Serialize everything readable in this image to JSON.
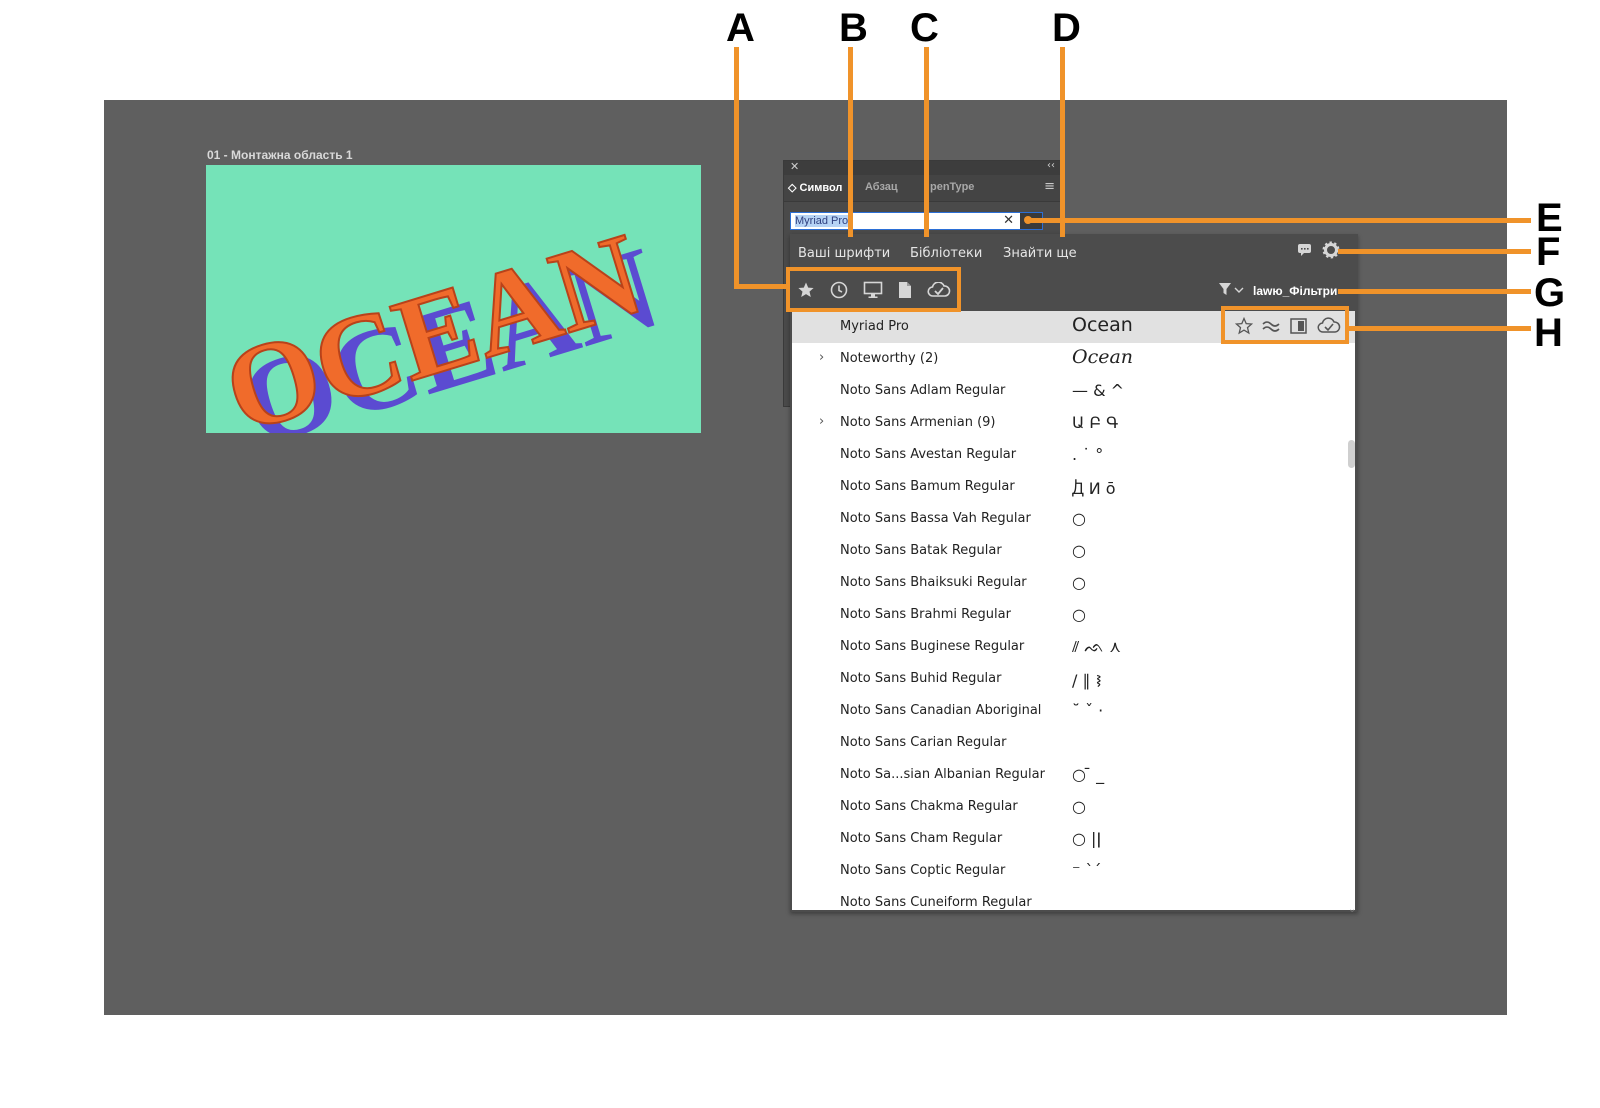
{
  "artboard": {
    "label": "01 - Монтажна область 1",
    "text": "OCEAN"
  },
  "panel": {
    "tabs": [
      {
        "label": "◇ Символ"
      },
      {
        "label": "Абзац"
      },
      {
        "label": "penType"
      }
    ],
    "font_field_value": "Myriad Pro",
    "close_glyph": "✕",
    "collapse_glyph": "‹‹",
    "menu_glyph": "≡",
    "clear_glyph": "✕"
  },
  "dropdown": {
    "tabs": [
      {
        "label": "Ваші шрифти"
      },
      {
        "label": "Бібліотеки"
      },
      {
        "label": "Знайти ще"
      }
    ],
    "filter_label": "lawю_Фільтри",
    "tool_icons": [
      "star-icon",
      "clock-icon",
      "monitor-icon",
      "document-icon",
      "cloud-check-icon"
    ],
    "fonts": [
      {
        "name": "Myriad Pro",
        "sample": "Ocean",
        "expandable": false,
        "selected": true
      },
      {
        "name": "Noteworthy (2)",
        "sample": "Ocean",
        "expandable": true
      },
      {
        "name": "Noto Sans Adlam Regular",
        "sample": "— & ^",
        "expandable": false
      },
      {
        "name": "Noto Sans Armenian (9)",
        "sample": "Ա Բ Գ",
        "expandable": true
      },
      {
        "name": "Noto Sans Avestan Regular",
        "sample": ". ˙ °",
        "expandable": false
      },
      {
        "name": "Noto Sans Bamum Regular",
        "sample": "Ꚁ И ō",
        "expandable": false
      },
      {
        "name": "Noto Sans Bassa Vah Regular",
        "sample": "○",
        "expandable": false
      },
      {
        "name": "Noto Sans Batak Regular",
        "sample": "○",
        "expandable": false
      },
      {
        "name": "Noto Sans Bhaiksuki Regular",
        "sample": "○",
        "expandable": false
      },
      {
        "name": "Noto Sans Brahmi Regular",
        "sample": "○",
        "expandable": false
      },
      {
        "name": "Noto Sans Buginese Regular",
        "sample": "⫽ ᨒ ⋏",
        "expandable": false
      },
      {
        "name": "Noto Sans Buhid Regular",
        "sample": "/ ∥ ᝢ",
        "expandable": false
      },
      {
        "name": "Noto Sans Canadian Aboriginal",
        "sample": "˘ ˇ ·",
        "expandable": false
      },
      {
        "name": "Noto Sans Carian Regular",
        "sample": "",
        "expandable": false
      },
      {
        "name": "Noto Sa...sian Albanian Regular",
        "sample": "○ ̄ _",
        "expandable": false
      },
      {
        "name": "Noto Sans Chakma Regular",
        "sample": "○",
        "expandable": false
      },
      {
        "name": "Noto Sans Cham Regular",
        "sample": "○ |ǀ",
        "expandable": false
      },
      {
        "name": "Noto Sans Coptic Regular",
        "sample": "⁻ ˋˊ",
        "expandable": false
      },
      {
        "name": "Noto Sans Cuneiform Regular",
        "sample": "",
        "expandable": false
      }
    ],
    "row_action_icons": [
      "star-outline-icon",
      "similar-icon",
      "preview-icon",
      "cloud-sync-icon"
    ]
  },
  "callouts": [
    "A",
    "B",
    "C",
    "D",
    "E",
    "F",
    "G",
    "H"
  ],
  "colors": {
    "workspace": "#5f5f5f",
    "artboard": "#75e3b8",
    "callout": "#f0932a",
    "ocean_orange": "#f06b2b",
    "ocean_shadow": "#5b4bd1"
  }
}
